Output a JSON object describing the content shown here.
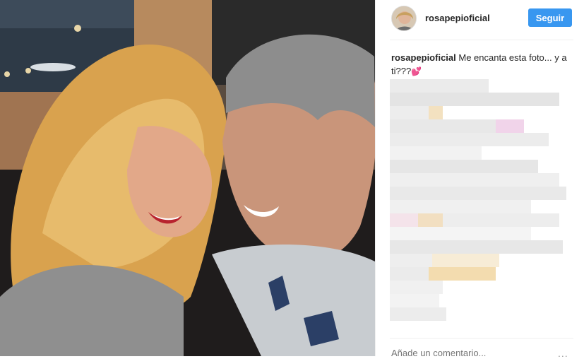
{
  "post": {
    "username": "rosapepioficial",
    "follow_label": "Seguir",
    "caption_user": "rosapepioficial",
    "caption_text": "Me encanta esta foto... y a ti???",
    "caption_emoji": "💕",
    "comment_placeholder": "Añade un comentario...",
    "more_icon": "..."
  },
  "colors": {
    "follow": "#3897f0",
    "text": "#262626",
    "muted": "#999999"
  },
  "icons": [
    "more-options-icon",
    "heart-emoji-icon"
  ]
}
